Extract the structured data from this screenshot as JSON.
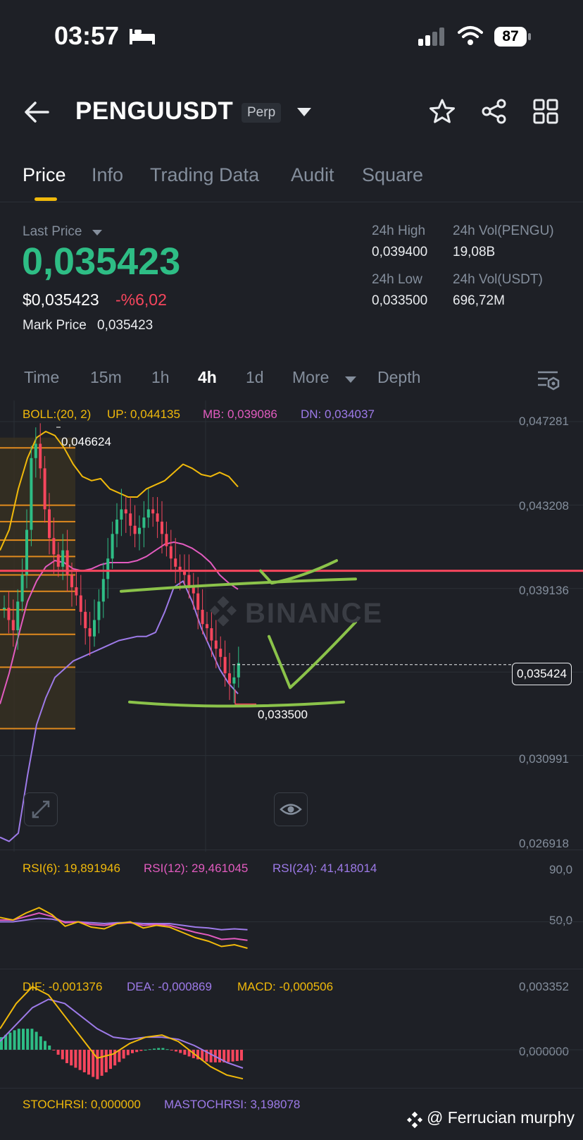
{
  "status_bar": {
    "time": "03:57",
    "battery": "87"
  },
  "header": {
    "symbol": "PENGUUSDT",
    "badge": "Perp"
  },
  "tabs": [
    "Price",
    "Info",
    "Trading Data",
    "Audit",
    "Square"
  ],
  "ticker": {
    "last_price_label": "Last Price",
    "last_price": "0,035423",
    "usd_price": "$0,035423",
    "change": "-%6,02",
    "mark_price_label": "Mark Price",
    "mark_price": "0,035423",
    "high_label": "24h High",
    "high": "0,039400",
    "low_label": "24h Low",
    "low": "0,033500",
    "vol_base_label": "24h Vol(PENGU)",
    "vol_base": "19,08B",
    "vol_quote_label": "24h Vol(USDT)",
    "vol_quote": "696,72M"
  },
  "intervals": [
    "Time",
    "15m",
    "1h",
    "4h",
    "1d",
    "More",
    "Depth"
  ],
  "colors": {
    "up": "#2ebd85",
    "down": "#f6465d",
    "accent": "#f0b90b",
    "bg": "#1e2026",
    "upper": "#f0b90b",
    "mid": "#e25bbf",
    "lower": "#9d7ae8",
    "drawing": "#8bc34a"
  },
  "chart_data": [
    {
      "type": "candlestick",
      "boll": {
        "label": "BOLL:(20, 2)",
        "up_label": "UP: 0,044135",
        "mb_label": "MB: 0,039086",
        "dn_label": "DN: 0,034037"
      },
      "y_ticks": [
        "0,047281",
        "0,043208",
        "0,039136",
        "0,030991",
        "0,026918"
      ],
      "ylim": [
        0.026918,
        0.047281
      ],
      "annotations": {
        "high": "0,046624",
        "low": "0,033500",
        "current": "0,035424"
      },
      "watermark": "BINANCE",
      "close_series": [
        0.0382,
        0.0376,
        0.0371,
        0.0385,
        0.0398,
        0.042,
        0.0455,
        0.0462,
        0.045,
        0.043,
        0.0416,
        0.0408,
        0.0402,
        0.041,
        0.0398,
        0.0392,
        0.0388,
        0.038,
        0.0372,
        0.0368,
        0.0376,
        0.0385,
        0.0396,
        0.0406,
        0.0418,
        0.0425,
        0.043,
        0.0428,
        0.0422,
        0.0418,
        0.0421,
        0.0426,
        0.043,
        0.0428,
        0.0424,
        0.0418,
        0.0412,
        0.0406,
        0.0402,
        0.04,
        0.0398,
        0.0393,
        0.0389,
        0.0381,
        0.0374,
        0.0372,
        0.0366,
        0.0362,
        0.0358,
        0.035,
        0.0345,
        0.0348,
        0.0355
      ],
      "upper_band": [
        0.041,
        0.042,
        0.044,
        0.0455,
        0.0465,
        0.0468,
        0.0466,
        0.046,
        0.0452,
        0.0446,
        0.0444,
        0.0445,
        0.044,
        0.0438,
        0.0436,
        0.0436,
        0.044,
        0.0442,
        0.0444,
        0.0448,
        0.0452,
        0.045,
        0.0447,
        0.0446,
        0.0448,
        0.0446,
        0.0441
      ],
      "middle_band": [
        0.0335,
        0.035,
        0.0368,
        0.0385,
        0.0395,
        0.0402,
        0.0405,
        0.0404,
        0.0401,
        0.04,
        0.0401,
        0.0403,
        0.0404,
        0.0404,
        0.0404,
        0.0405,
        0.0407,
        0.041,
        0.0413,
        0.0414,
        0.0413,
        0.0411,
        0.0408,
        0.0404,
        0.0398,
        0.0394,
        0.0391
      ],
      "lower_band": [
        0.027,
        0.0268,
        0.0272,
        0.03,
        0.0325,
        0.0338,
        0.0348,
        0.0352,
        0.0356,
        0.0358,
        0.036,
        0.0362,
        0.0364,
        0.0366,
        0.0367,
        0.0368,
        0.0368,
        0.037,
        0.038,
        0.0392,
        0.0395,
        0.0385,
        0.0372,
        0.0362,
        0.0352,
        0.0345,
        0.034
      ],
      "fib_levels": [
        0.046,
        0.0432,
        0.0424,
        0.0415,
        0.0407,
        0.0398,
        0.039,
        0.0381,
        0.0369,
        0.0353,
        0.0323
      ]
    },
    {
      "type": "line",
      "name_labels": [
        "RSI(6): 19,891946",
        "RSI(12): 29,461045",
        "RSI(24): 41,418014"
      ],
      "y_ticks": [
        "90,0",
        "50,0"
      ],
      "rsi6": [
        55,
        52,
        60,
        66,
        58,
        45,
        50,
        44,
        42,
        48,
        50,
        43,
        46,
        44,
        38,
        32,
        28,
        22,
        24,
        20
      ],
      "rsi12": [
        52,
        52,
        56,
        60,
        56,
        49,
        50,
        47,
        46,
        48,
        49,
        46,
        47,
        46,
        42,
        38,
        35,
        30,
        31,
        29
      ],
      "rsi24": [
        50,
        50,
        52,
        54,
        53,
        50,
        50,
        49,
        48,
        49,
        49,
        48,
        48,
        48,
        46,
        44,
        43,
        41,
        42,
        41
      ]
    },
    {
      "type": "line",
      "name_labels": [
        "DIF: -0,001376",
        "DEA: -0,000869",
        "MACD: -0,000506"
      ],
      "y_ticks": [
        "0,003352",
        "0,000000"
      ],
      "dif": [
        0.001,
        0.0022,
        0.003,
        0.0026,
        0.0016,
        0.0006,
        -0.0004,
        -0.0002,
        0.0003,
        0.0006,
        0.0007,
        0.0004,
        -0.0002,
        -0.0008,
        -0.0012,
        -0.00138
      ],
      "dea": [
        0.0004,
        0.0012,
        0.002,
        0.0024,
        0.0022,
        0.0016,
        0.001,
        0.0006,
        0.0005,
        0.0006,
        0.0006,
        0.0005,
        0.0002,
        -0.0002,
        -0.0006,
        -0.00087
      ]
    },
    {
      "type": "line",
      "name_labels": [
        "STOCHRSI: 0,000000",
        "MASTOCHRSI: 3,198078"
      ]
    }
  ],
  "footer": {
    "watermark": "@ Ferrucian murphy"
  }
}
